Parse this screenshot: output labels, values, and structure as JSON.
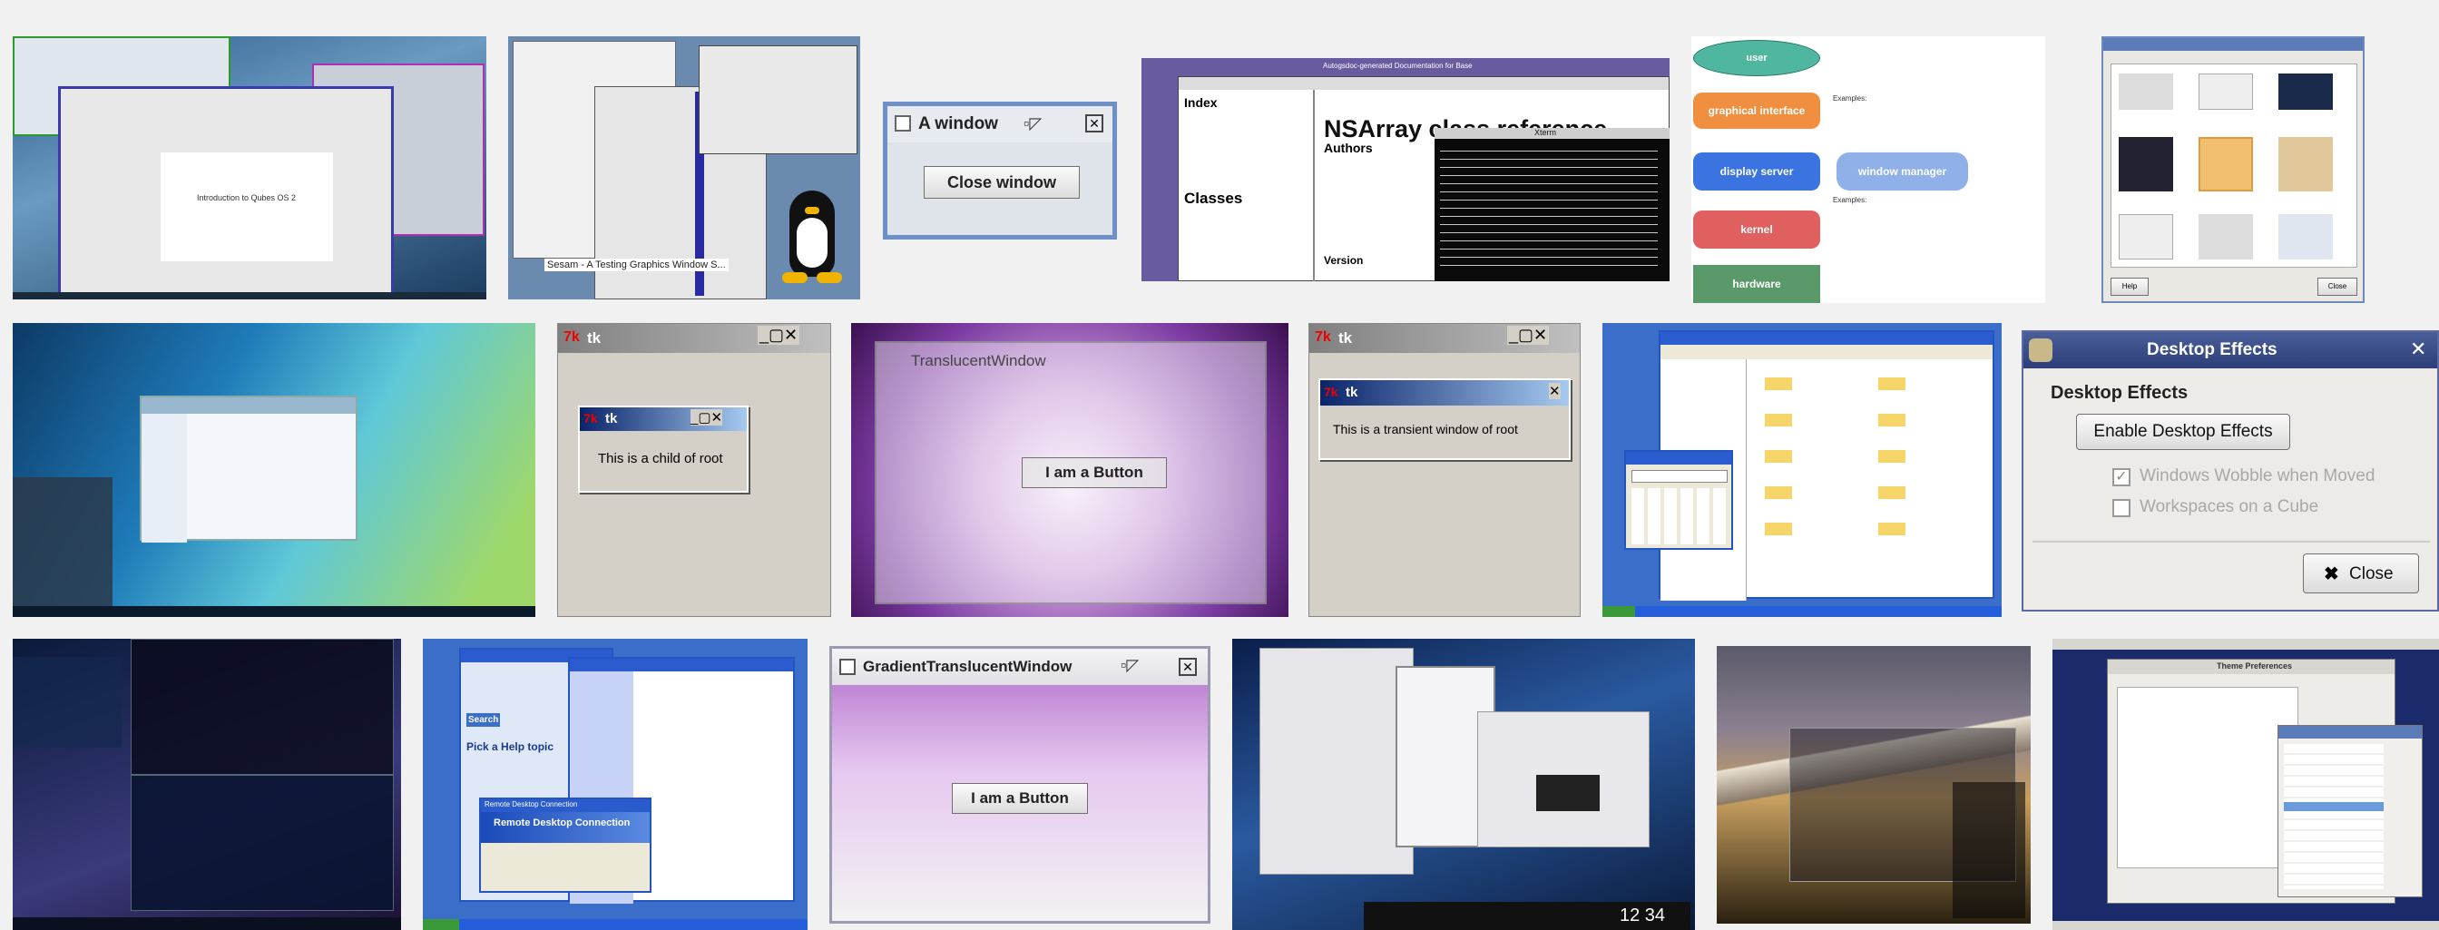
{
  "tiles": {
    "qubes": {
      "slide_title": "Introduction to Qubes OS 2"
    },
    "xnest": {
      "caption": "Sesam - A Testing Graphics Window S..."
    },
    "awindow": {
      "title": "A window",
      "button": "Close window"
    },
    "nsarray": {
      "top_caption": "Autogsdoc-generated Documentation for Base",
      "heading": "NSArray class reference",
      "index_label": "Index",
      "classes_label": "Classes",
      "authors_label": "Authors",
      "version_label": "Version",
      "terminal_title": "Xterm"
    },
    "display_server_diagram": {
      "user": "user",
      "graphical_interface": "graphical interface",
      "display_server": "display server",
      "window_manager": "window manager",
      "kernel": "kernel",
      "hardware": "hardware",
      "examples_1": "Examples:",
      "examples_2": "Examples:"
    },
    "gnome_appearance": {
      "close_label": "Close",
      "help_label": "Help"
    },
    "tk_child": {
      "app": "tk",
      "message": "This is a child of root"
    },
    "translucent": {
      "title": "TranslucentWindow",
      "button": "I am a Button"
    },
    "tk_transient": {
      "app": "tk",
      "message": "This is a transient window of root"
    },
    "desktop_effects": {
      "window_title": "Desktop Effects",
      "heading": "Desktop Effects",
      "enable_button": "Enable Desktop Effects",
      "option_1": "Windows Wobble when Moved",
      "option_2": "Workspaces on a Cube",
      "close_button": "Close"
    },
    "xp_help": {
      "title_1": "Pick a Help topic",
      "rdc_title": "Remote Desktop Connection",
      "rdc_heading": "Remote Desktop Connection",
      "search_label": "Search"
    },
    "gradient": {
      "title": "GradientTranslucentWindow",
      "button": "I am a Button"
    },
    "windows7_clock": {
      "time": "12 34"
    },
    "theme_prefs": {
      "title": "Theme Preferences"
    }
  },
  "colors": {
    "page_bg": "#f1f1f1"
  }
}
